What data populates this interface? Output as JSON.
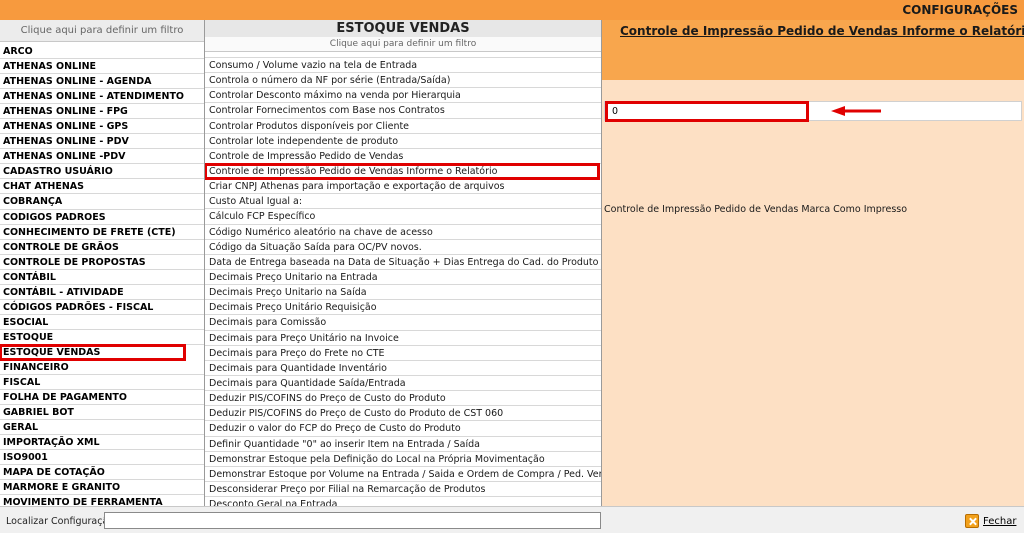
{
  "header": {
    "title": "CONFIGURAÇÕES"
  },
  "left_panel": {
    "filter_text": "Clique aqui para definir um filtro",
    "selected_index": 22,
    "items": [
      "ARCO",
      "ATHENAS ONLINE",
      "ATHENAS ONLINE - AGENDA",
      "ATHENAS ONLINE - ATENDIMENTO",
      "ATHENAS ONLINE - FPG",
      "ATHENAS ONLINE - GPS",
      "ATHENAS ONLINE - PDV",
      "ATHENAS ONLINE -PDV",
      "CADASTRO USUÁRIO",
      "CHAT ATHENAS",
      "COBRANÇA",
      "CODIGOS PADROES",
      "CONHECIMENTO DE FRETE (CTE)",
      "CONTROLE DE GRÃOS",
      "CONTROLE DE PROPOSTAS",
      "CONTÁBIL",
      "CONTÁBIL - ATIVIDADE",
      "CÓDIGOS PADRÕES - FISCAL",
      "ESOCIAL",
      "ESTOQUE",
      "ESTOQUE VENDAS",
      "FINANCEIRO",
      "FISCAL",
      "FOLHA DE PAGAMENTO",
      "GABRIEL BOT",
      "GERAL",
      "IMPORTAÇÃO XML",
      "ISO9001",
      "MAPA DE COTAÇÃO",
      "MARMORE E GRANITO",
      "MOVIMENTO DE FERRAMENTA"
    ]
  },
  "middle_panel": {
    "title": "ESTOQUE VENDAS",
    "filter_text": "Clique aqui para definir um filtro",
    "selected_index": 7,
    "items": [
      "Consumo / Volume vazio na tela de Entrada",
      "Controla o número da NF por série (Entrada/Saída)",
      "Controlar Desconto máximo na venda por Hierarquia",
      "Controlar Fornecimentos com Base nos Contratos",
      "Controlar Produtos disponíveis por Cliente",
      "Controlar lote independente de produto",
      "Controle de Impressão Pedido de Vendas",
      "Controle de Impressão Pedido de Vendas Informe o Relatório",
      "Criar CNPJ Athenas para importação e exportação de arquivos",
      "Custo Atual Igual a:",
      "Cálculo FCP Específico",
      "Código Numérico aleatório na chave de acesso",
      "Código da Situação Saída para OC/PV novos.",
      "Data de Entrega baseada na Data de Situação + Dias Entrega do Cad. do Produto",
      "Decimais Preço Unitario na Entrada",
      "Decimais Preço Unitario na Saída",
      "Decimais Preço Unitário Requisição",
      "Decimais para Comissão",
      "Decimais para Preço Unitário na Invoice",
      "Decimais para Preço do Frete no CTE",
      "Decimais para Quantidade Inventário",
      "Decimais para Quantidade Saída/Entrada",
      "Deduzir PIS/COFINS do Preço de Custo do Produto",
      "Deduzir PIS/COFINS do Preço de Custo do Produto de CST 060",
      "Deduzir o valor do FCP do Preço de Custo do Produto",
      "Definir Quantidade \"0\" ao inserir Item na Entrada / Saída",
      "Demonstrar Estoque pela Definição do Local na Própria Movimentação",
      "Demonstrar Estoque por Volume na Entrada / Saida e Ordem de Compra / Ped. Vendas",
      "Desconsiderar Preço por Filial na Remarcação de Produtos",
      "Desconto Geral na Entrada"
    ]
  },
  "right_panel": {
    "title": "Controle de Impressão Pedido de Vendas Informe o Relatório",
    "value": "0",
    "description": "Controle de Impressão Pedido de Vendas Marca Como Impresso"
  },
  "bottom_bar": {
    "search_label": "Localizar Configuração:",
    "search_value": "",
    "close_label": "Fechar"
  },
  "colors": {
    "accent_orange": "#f79a3e",
    "panel_peach": "#fde0c4",
    "highlight_red": "#e00000"
  }
}
